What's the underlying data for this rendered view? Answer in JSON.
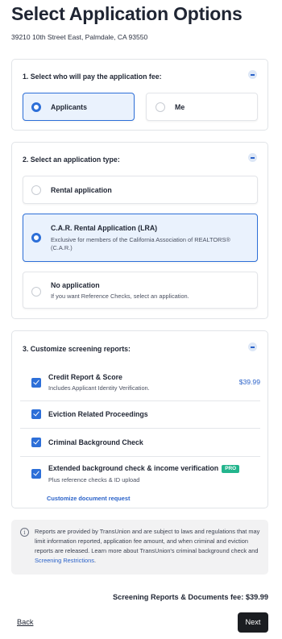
{
  "header": {
    "title": "Select Application Options",
    "address": "39210 10th Street East, Palmdale, CA 93550"
  },
  "payer_section": {
    "title": "1. Select who will pay the application fee:",
    "options": [
      {
        "label": "Applicants",
        "selected": true
      },
      {
        "label": "Me",
        "selected": false
      }
    ]
  },
  "type_section": {
    "title": "2. Select an application type:",
    "options": [
      {
        "label": "Rental application",
        "description": "",
        "selected": false
      },
      {
        "label": "C.A.R. Rental Application (LRA)",
        "description": "Exclusive for members of the California Association of REALTORS® (C.A.R.)",
        "selected": true
      },
      {
        "label": "No application",
        "description": "If you want Reference Checks, select an application.",
        "selected": false
      }
    ]
  },
  "screening_section": {
    "title": "3. Customize screening reports:",
    "items": [
      {
        "label": "Credit Report & Score",
        "description": "Includes Applicant Identity Verification.",
        "price": "$39.99",
        "checked": true
      },
      {
        "label": "Eviction Related Proceedings",
        "checked": true
      },
      {
        "label": "Criminal Background Check",
        "checked": true
      },
      {
        "label": "Extended background check & income verification",
        "badge": "PRO",
        "description": "Plus reference checks & ID upload",
        "checked": true
      }
    ],
    "customize_link": "Customize document request"
  },
  "notice": {
    "text": "Reports are provided by TransUnion and are subject to laws and regulations that may limit information reported, application fee amount, and when criminal and eviction reports are released. Learn more about TransUnion's criminal background check and ",
    "link": "Screening Restrictions",
    "end": "."
  },
  "footer": {
    "total": "Screening Reports & Documents fee: $39.99",
    "back": "Back",
    "next": "Next"
  },
  "colors": {
    "accent": "#2d6fd8",
    "selected_bg": "#eaf2fd",
    "badge": "#23b58d",
    "next_button": "#1b1d21"
  }
}
